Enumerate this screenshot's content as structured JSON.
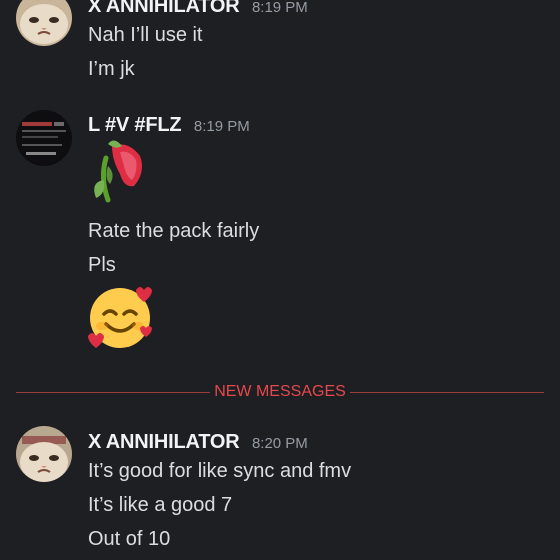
{
  "messages_top": {
    "author": "X ANNIHILATOR",
    "time": "8:19 PM",
    "lines": [
      "Nah I’ll use it",
      "I’m jk"
    ]
  },
  "group_2": {
    "author": "L #V #FLZ",
    "time": "8:19 PM",
    "sticker_icon": "wilted-rose-emoji",
    "lines": [
      "Rate the pack fairly",
      "Pls"
    ],
    "emoji_icon": "smiling-face-with-hearts-emoji"
  },
  "divider": {
    "label": "NEW MESSAGES",
    "color": "#e5484d"
  },
  "group_3": {
    "author": "X ANNIHILATOR",
    "time": "8:20 PM",
    "lines": [
      "It’s good for like sync and fmv",
      "It’s like a good 7",
      "Out of 10"
    ]
  },
  "colors": {
    "background": "#1e1f22",
    "author": "#f2f3f5",
    "message": "#dbdee1",
    "timestamp": "#949ba4"
  }
}
